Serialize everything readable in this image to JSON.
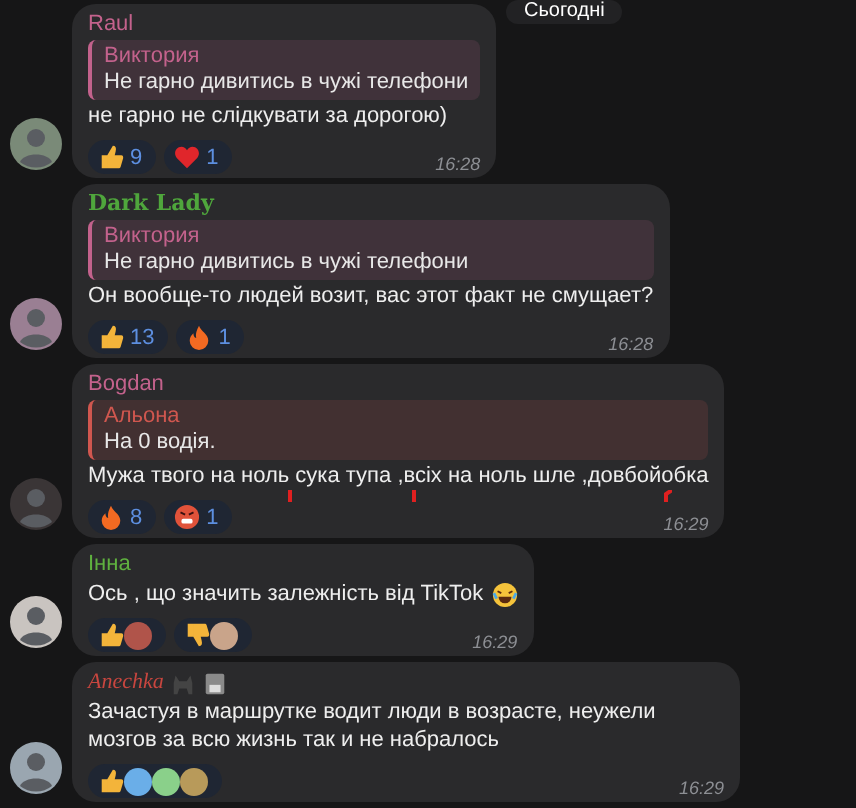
{
  "date_header": "Сьогодні",
  "messages": [
    {
      "sender": {
        "name": "Raul",
        "kind": "plain",
        "color": "#c3628c"
      },
      "reply": {
        "author": "Виктория",
        "text": "Не гарно дивитись в чужі телефони",
        "color": "#c3628c"
      },
      "text": "не гарно не слідкувати за дорогою)",
      "reactions": [
        {
          "kind": "thumb",
          "count": "9"
        },
        {
          "kind": "heart",
          "count": "1"
        }
      ],
      "time": "16:28",
      "avatar": {
        "color": "#7a8a78"
      }
    },
    {
      "sender": {
        "name": "Dark Lady",
        "kind": "blackletter",
        "color": "#4fa63c"
      },
      "reply": {
        "author": "Виктория",
        "text": "Не гарно дивитись в чужі телефони",
        "color": "#c3628c"
      },
      "text": "Он вообще-то людей возит, вас этот факт не смущает?",
      "reactions": [
        {
          "kind": "thumb",
          "count": "13"
        },
        {
          "kind": "fire",
          "count": "1"
        }
      ],
      "time": "16:28",
      "avatar": {
        "color": "#9a7f93"
      }
    },
    {
      "sender": {
        "name": "Bogdan",
        "kind": "plain",
        "color": "#c3628c"
      },
      "reply": {
        "author": "Альона",
        "text": "На 0 водія.",
        "color": "#d0574f"
      },
      "text": "Мужа твого на ноль сука тупа ,всіх на ноль шле ,довбойобка",
      "reactions": [
        {
          "kind": "fire",
          "count": "8"
        },
        {
          "kind": "angry",
          "count": "1"
        }
      ],
      "time": "16:29",
      "scribbles": true,
      "avatar": {
        "color": "#3a3536"
      }
    },
    {
      "sender": {
        "name": "Інна",
        "kind": "plain",
        "color": "#5fb13f"
      },
      "text": "Ось , що значить залежність від TikTok",
      "trailing_icon": {
        "kind": "laughing"
      },
      "reactions": [
        {
          "kind": "thumb",
          "avatars": [
            {
              "color": "#b0544a"
            }
          ]
        },
        {
          "kind": "thumb-down",
          "avatars": [
            {
              "color": "#c9a48a"
            }
          ]
        }
      ],
      "time": "16:29",
      "avatar": {
        "color": "#c9c4c0"
      }
    },
    {
      "sender": {
        "name": "Anechka",
        "kind": "script",
        "color": "#c8463f"
      },
      "name_icons": true,
      "text": "Зачастуя в маршрутке водит люди в возрасте, неужели мозгов за всю жизнь так и не набралось",
      "reactions": [
        {
          "kind": "thumb",
          "avatars": [
            {
              "color": "#6aaee8"
            },
            {
              "color": "#8ad08a"
            },
            {
              "color": "#b89a5a"
            }
          ]
        }
      ],
      "time": "16:29",
      "avatar": {
        "color": "#9aa6b0"
      }
    }
  ]
}
